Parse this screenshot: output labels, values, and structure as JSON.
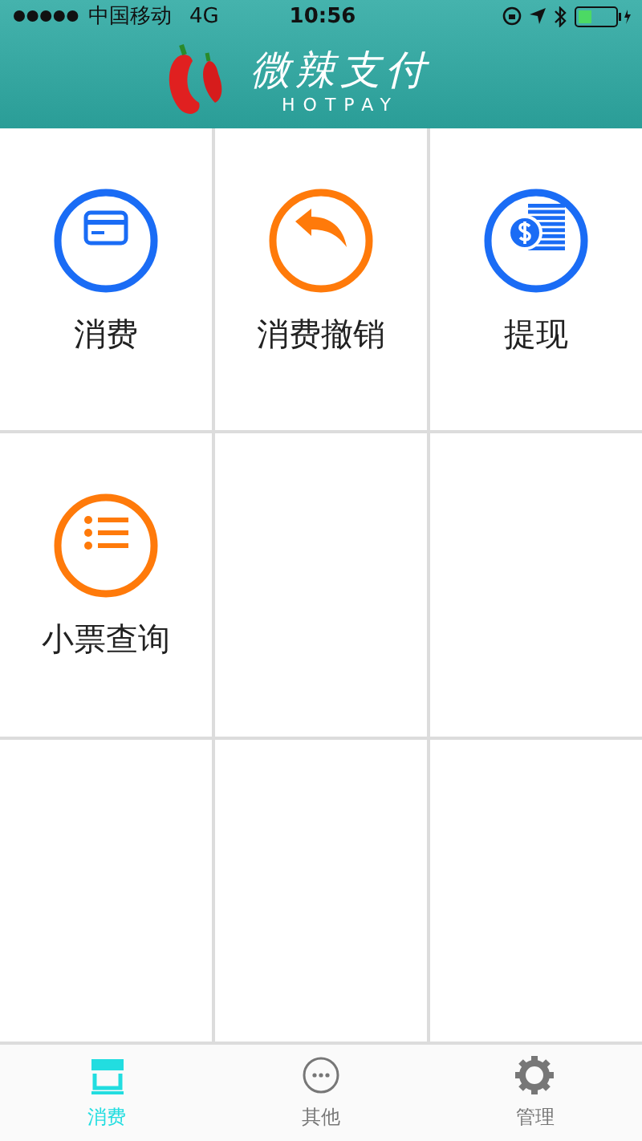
{
  "status_bar": {
    "carrier": "中国移动",
    "network": "4G",
    "time": "10:56"
  },
  "header": {
    "title": "微辣支付",
    "subtitle": "HOTPAY"
  },
  "grid": [
    {
      "kind": "card",
      "label": "消费",
      "color": "#1a6cf5"
    },
    {
      "kind": "undo",
      "label": "消费撤销",
      "color": "#ff7a0a"
    },
    {
      "kind": "cash",
      "label": "提现",
      "color": "#1a6cf5"
    },
    {
      "kind": "list",
      "label": "小票查询",
      "color": "#ff7a0a"
    }
  ],
  "tabs": [
    {
      "kind": "store",
      "label": "消费",
      "selected": true
    },
    {
      "kind": "more",
      "label": "其他",
      "selected": false
    },
    {
      "kind": "gear",
      "label": "管理",
      "selected": false
    }
  ]
}
